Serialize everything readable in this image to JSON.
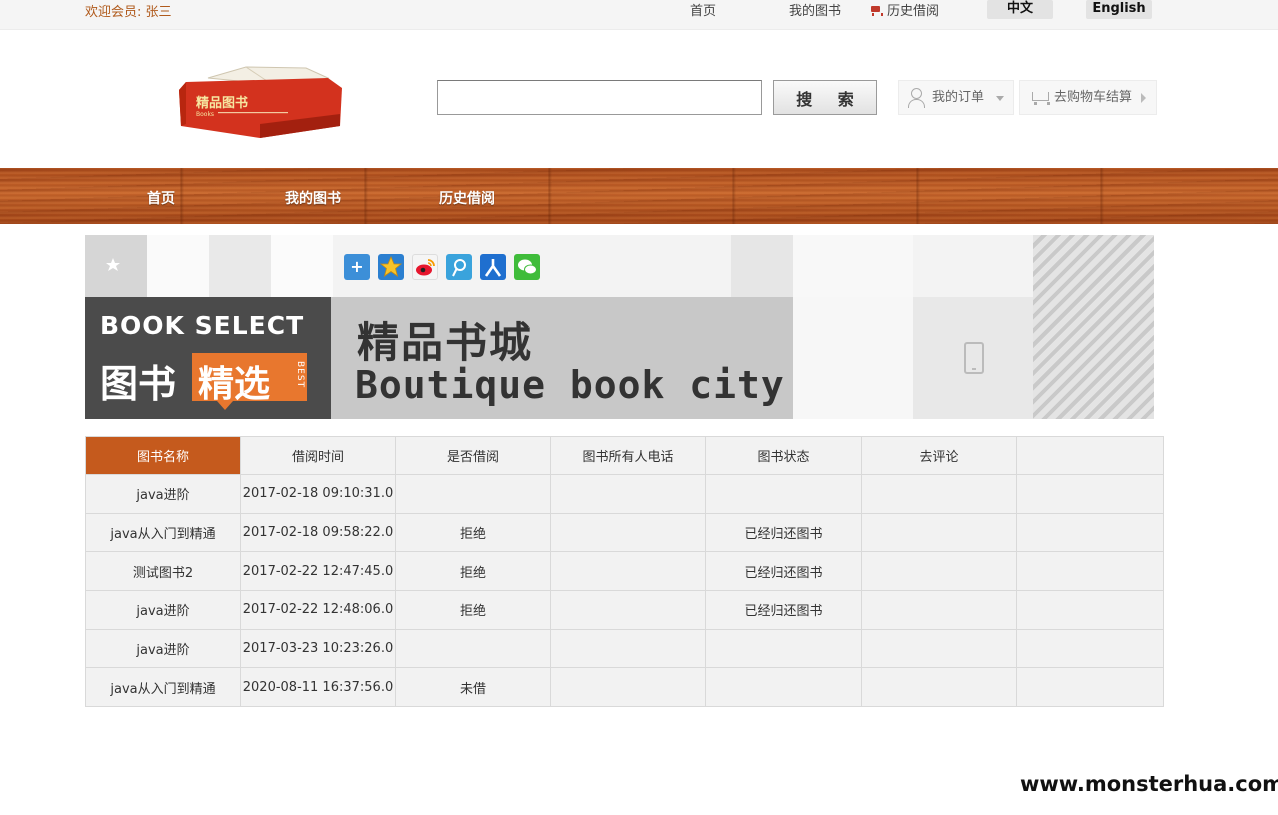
{
  "topbar": {
    "welcome": "欢迎会员: 张三",
    "links": [
      "首页",
      "我的图书",
      "历史借阅"
    ],
    "lang_zh": "中文",
    "lang_en": "English"
  },
  "logo": {
    "title": "精品图书",
    "subtitle": "Books"
  },
  "search": {
    "value": "",
    "placeholder": "",
    "button": "搜 索"
  },
  "header": {
    "orders": "我的订单",
    "cart": "去购物车结算"
  },
  "nav": {
    "items": [
      "首页",
      "我的图书",
      "历史借阅"
    ]
  },
  "banner": {
    "book_select_en": "BOOK SELECT",
    "book_select_cn1": "图书",
    "book_select_cn2": "精选",
    "book_select_best": "BEST",
    "city_cn": "精品书城",
    "city_en": "Boutique book city",
    "share_icons": [
      "add-icon",
      "favorite-star-icon",
      "weibo-icon",
      "tencent-weibo-icon",
      "renren-icon",
      "wechat-icon"
    ]
  },
  "table": {
    "columns": [
      "图书名称",
      "借阅时间",
      "是否借阅",
      "图书所有人电话",
      "图书状态",
      "去评论",
      ""
    ],
    "rows": [
      [
        "java进阶",
        "2017-02-18 09:10:31.0",
        "",
        "",
        "",
        "",
        ""
      ],
      [
        "java从入门到精通",
        "2017-02-18 09:58:22.0",
        "拒绝",
        "",
        "已经归还图书",
        "",
        ""
      ],
      [
        "测试图书2",
        "2017-02-22 12:47:45.0",
        "拒绝",
        "",
        "已经归还图书",
        "",
        ""
      ],
      [
        "java进阶",
        "2017-02-22 12:48:06.0",
        "拒绝",
        "",
        "已经归还图书",
        "",
        ""
      ],
      [
        "java进阶",
        "2017-03-23 10:23:26.0",
        "",
        "",
        "",
        "",
        ""
      ],
      [
        "java从入门到精通",
        "2020-08-11 16:37:56.0",
        "未借",
        "",
        "",
        "",
        ""
      ]
    ]
  },
  "watermark": "www.monsterhua.com",
  "colors": {
    "accent": "#c55a1d",
    "welcome": "#b05a1c",
    "wood": "#b5511f"
  }
}
